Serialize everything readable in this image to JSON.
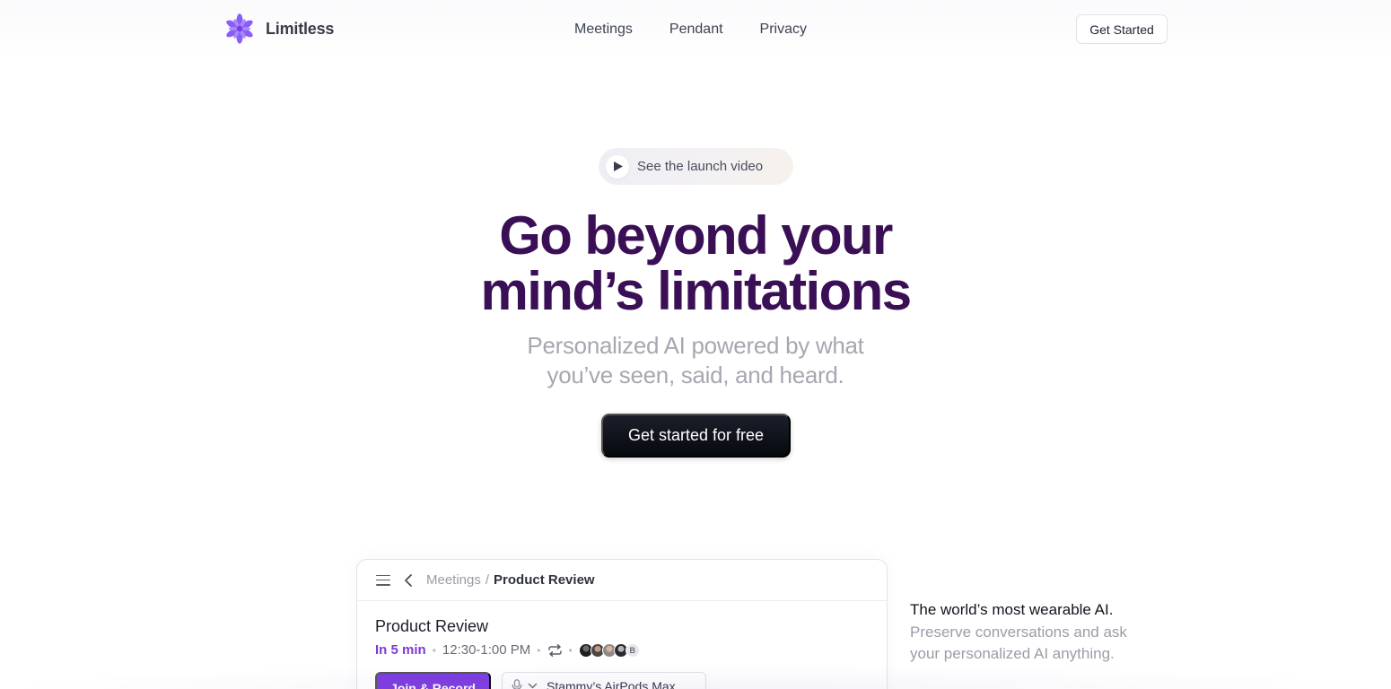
{
  "brand": {
    "name": "Limitless",
    "logo_icon": "flower-logo-icon",
    "accent": "#8b5cf6"
  },
  "nav": {
    "links": [
      "Meetings",
      "Pendant",
      "Privacy"
    ],
    "cta": "Get Started"
  },
  "hero": {
    "video_pill": {
      "label": "See the launch video",
      "icon": "play-icon"
    },
    "headline": [
      "Go beyond your",
      "mind’s limitations"
    ],
    "subhead": [
      "Personalized AI powered by what",
      "you’ve seen, said, and heard."
    ],
    "cta": "Get started for free",
    "headline_color": "#3a0f56"
  },
  "app_preview": {
    "breadcrumb": {
      "parent": "Meetings",
      "separator": "/",
      "current": "Product Review"
    },
    "meeting": {
      "title": "Product Review",
      "starts_in": "In 5 min",
      "time": "12:30-1:00 PM",
      "attendee_more_label": "B"
    },
    "join_button": "Join & Record",
    "device": "Stammy’s AirPods Max",
    "accent": "#7c3ae0"
  },
  "side_copy": {
    "strong": "The world’s most wearable AI.",
    "muted": [
      "Preserve conversations and ask",
      "your personalized AI anything."
    ]
  }
}
